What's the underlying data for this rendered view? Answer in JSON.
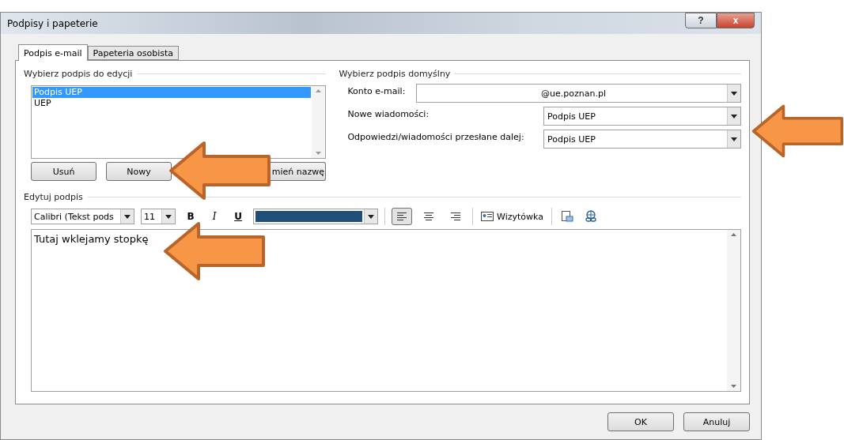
{
  "window": {
    "title": "Podpisy i papeterie",
    "help": "?",
    "close": "x"
  },
  "tabs": [
    {
      "label": "Podpis e-mail",
      "selected": true
    },
    {
      "label": "Papeteria osobista",
      "selected": false
    }
  ],
  "signature_list": {
    "legend": "Wybierz podpis do edycji",
    "items": [
      {
        "label": "Podpis UEP",
        "selected": true
      },
      {
        "label": "UEP",
        "selected": false
      }
    ],
    "buttons": [
      "Usuń",
      "Nowy",
      "mień nazwę"
    ]
  },
  "default_signature": {
    "legend": "Wybierz podpis domyślny",
    "fields": [
      {
        "label": "Konto e-mail:",
        "value": "@ue.poznan.pl",
        "kind": "wide"
      },
      {
        "label": "Nowe wiadomości:",
        "value": "Podpis UEP",
        "kind": "narrow"
      },
      {
        "label": "Odpowiedzi/wiadomości przesłane dalej:",
        "value": "Podpis UEP",
        "kind": "narrow"
      }
    ]
  },
  "editor": {
    "legend": "Edytuj podpis",
    "font": "Calibri (Tekst pods",
    "size": "11",
    "bold": "B",
    "italic": "I",
    "underline": "U",
    "color": "#1f4e79",
    "align": [
      {
        "selected": true
      },
      {
        "selected": false
      },
      {
        "selected": false
      }
    ],
    "business_card": "Wizytówka",
    "text": "Tutaj wklejamy stopkę"
  },
  "buttons": [
    "OK",
    "Anuluj"
  ],
  "annotations": [
    {
      "kind": "arrow"
    },
    {
      "kind": "arrow"
    },
    {
      "kind": "arrow"
    }
  ]
}
